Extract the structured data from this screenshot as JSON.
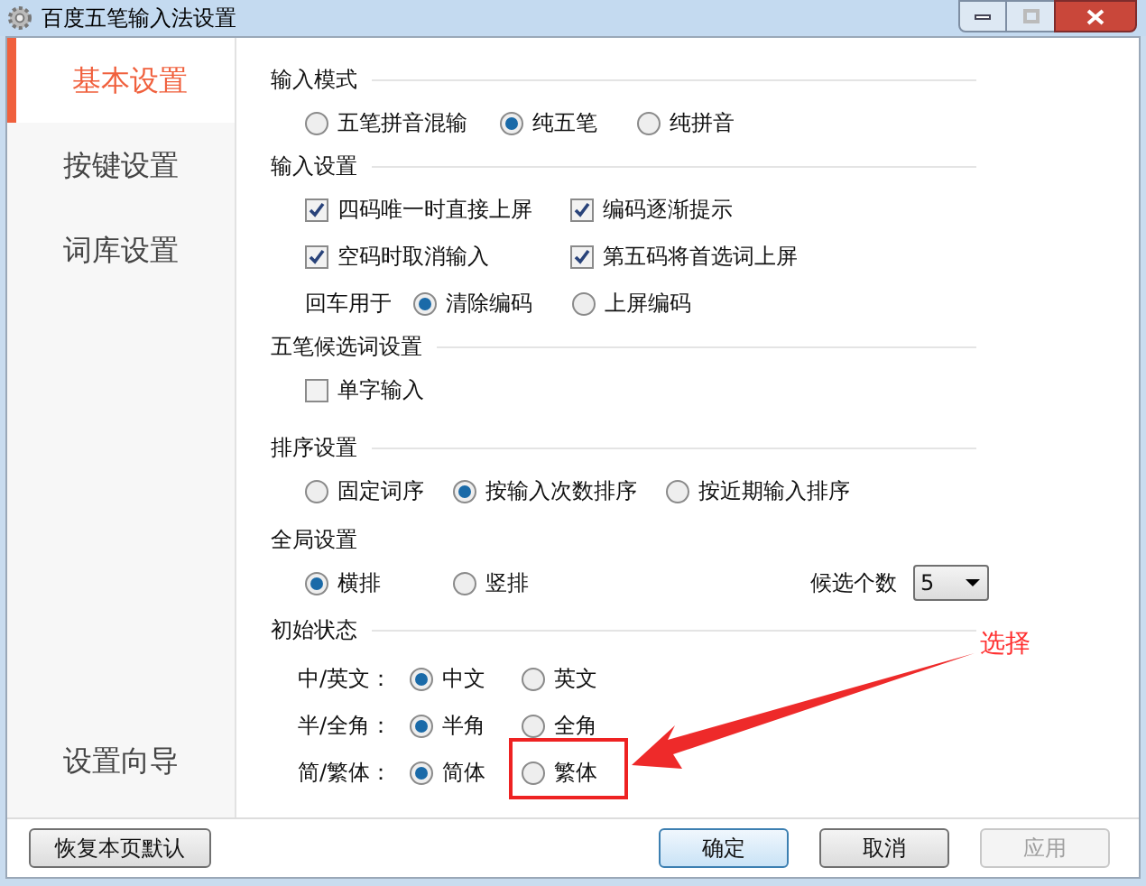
{
  "window": {
    "title": "百度五笔输入法设置"
  },
  "sidebar": {
    "items": [
      {
        "label": "基本设置",
        "selected": true
      },
      {
        "label": "按键设置",
        "selected": false
      },
      {
        "label": "词库设置",
        "selected": false
      }
    ],
    "footer_item": {
      "label": "设置向导",
      "selected": false
    }
  },
  "sections": [
    {
      "title": "输入模式",
      "rows": [
        {
          "kind": "radios",
          "options": [
            {
              "label": "五笔拼音混输",
              "selected": false
            },
            {
              "label": "纯五笔",
              "selected": true
            },
            {
              "label": "纯拼音",
              "selected": false
            }
          ]
        }
      ]
    },
    {
      "title": "输入设置",
      "rows": [
        {
          "kind": "checks",
          "options": [
            {
              "label": "四码唯一时直接上屏",
              "checked": true
            },
            {
              "label": "编码逐渐提示",
              "checked": true
            }
          ]
        },
        {
          "kind": "checks",
          "options": [
            {
              "label": "空码时取消输入",
              "checked": true
            },
            {
              "label": "第五码将首选词上屏",
              "checked": true
            }
          ]
        },
        {
          "kind": "radios",
          "label": "回车用于",
          "options": [
            {
              "label": "清除编码",
              "selected": true
            },
            {
              "label": "上屏编码",
              "selected": false
            }
          ]
        }
      ]
    },
    {
      "title": "五笔候选词设置",
      "rows": [
        {
          "kind": "checks",
          "options": [
            {
              "label": "单字输入",
              "checked": false
            }
          ]
        }
      ]
    },
    {
      "title": "排序设置",
      "rows": [
        {
          "kind": "radios",
          "options": [
            {
              "label": "固定词序",
              "selected": false
            },
            {
              "label": "按输入次数排序",
              "selected": true
            },
            {
              "label": "按近期输入排序",
              "selected": false
            }
          ]
        }
      ]
    },
    {
      "title": "全局设置",
      "rows": [
        {
          "kind": "radios",
          "options": [
            {
              "label": "横排",
              "selected": true
            },
            {
              "label": "竖排",
              "selected": false
            }
          ],
          "select": {
            "label": "候选个数",
            "value": "5"
          }
        }
      ]
    },
    {
      "title": "初始状态",
      "rows": [
        {
          "kind": "radios",
          "label": "中/英文：",
          "options": [
            {
              "label": "中文",
              "selected": true
            },
            {
              "label": "英文",
              "selected": false
            }
          ]
        },
        {
          "kind": "radios",
          "label": "半/全角：",
          "options": [
            {
              "label": "半角",
              "selected": true
            },
            {
              "label": "全角",
              "selected": false
            }
          ]
        },
        {
          "kind": "radios",
          "label": "简/繁体：",
          "options": [
            {
              "label": "简体",
              "selected": true
            },
            {
              "label": "繁体",
              "selected": false
            }
          ]
        }
      ]
    }
  ],
  "buttons": [
    {
      "label": "恢复本页默认",
      "disabled": false
    },
    {
      "label": "确定",
      "disabled": false
    },
    {
      "label": "取消",
      "disabled": false
    },
    {
      "label": "应用",
      "disabled": true
    }
  ],
  "annotation": {
    "label": "选择"
  }
}
